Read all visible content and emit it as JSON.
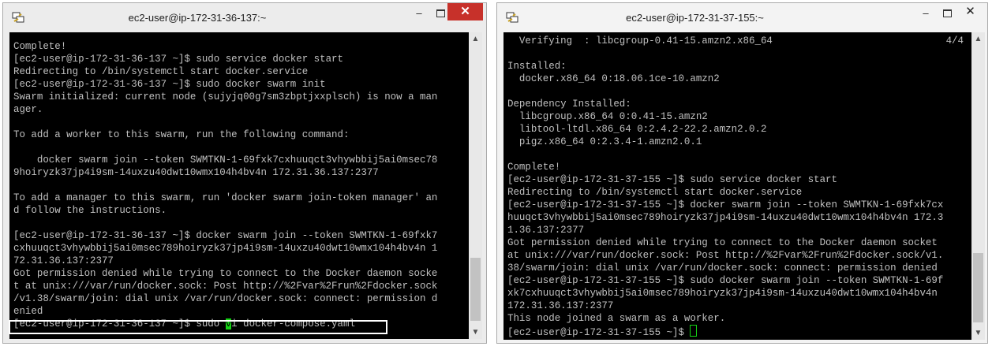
{
  "left_window": {
    "title": "ec2-user@ip-172-31-36-137:~",
    "controls": {
      "minimize": "–",
      "close": "✕"
    },
    "lines": [
      "Complete!",
      "[ec2-user@ip-172-31-36-137 ~]$ sudo service docker start",
      "Redirecting to /bin/systemctl start docker.service",
      "[ec2-user@ip-172-31-36-137 ~]$ sudo docker swarm init",
      "Swarm initialized: current node (sujyjq00g7sm3zbptjxxplsch) is now a man",
      "ager.",
      "",
      "To add a worker to this swarm, run the following command:",
      "",
      "    docker swarm join --token SWMTKN-1-69fxk7cxhuuqct3vhywbbij5ai0msec78",
      "9hoiryzk37jp4i9sm-14uxzu40dwt10wmx104h4bv4n 172.31.36.137:2377",
      "",
      "To add a manager to this swarm, run 'docker swarm join-token manager' an",
      "d follow the instructions.",
      "",
      "[ec2-user@ip-172-31-36-137 ~]$ docker swarm join --token SWMTKN-1-69fxk7",
      "cxhuuqct3vhywbbij5ai0msec789hoiryzk37jp4i9sm-14uxzu40dwt10wmx104h4bv4n 1",
      "72.31.36.137:2377",
      "Got permission denied while trying to connect to the Docker daemon socke",
      "t at unix:///var/run/docker.sock: Post http://%2Fvar%2Frun%2Fdocker.sock",
      "/v1.38/swarm/join: dial unix /var/run/docker.sock: connect: permission d",
      "enied"
    ],
    "prompt_line": {
      "before": "[ec2-user@ip-172-31-36-137 ~]$ sudo ",
      "cursor": "v",
      "after": "i docker-compose.yaml"
    }
  },
  "right_window": {
    "title": "ec2-user@ip-172-31-37-155:~",
    "controls": {
      "minimize": "–",
      "close": "✕"
    },
    "first_line": {
      "text": "  Verifying  : libcgroup-0.41-15.amzn2.x86_64",
      "right": "4/4"
    },
    "lines": [
      "",
      "Installed:",
      "  docker.x86_64 0:18.06.1ce-10.amzn2",
      "",
      "Dependency Installed:",
      "  libcgroup.x86_64 0:0.41-15.amzn2",
      "  libtool-ltdl.x86_64 0:2.4.2-22.2.amzn2.0.2",
      "  pigz.x86_64 0:2.3.4-1.amzn2.0.1",
      "",
      "Complete!",
      "[ec2-user@ip-172-31-37-155 ~]$ sudo service docker start",
      "Redirecting to /bin/systemctl start docker.service",
      "[ec2-user@ip-172-31-37-155 ~]$ docker swarm join --token SWMTKN-1-69fxk7cx",
      "huuqct3vhywbbij5ai0msec789hoiryzk37jp4i9sm-14uxzu40dwt10wmx104h4bv4n 172.3",
      "1.36.137:2377",
      "Got permission denied while trying to connect to the Docker daemon socket",
      "at unix:///var/run/docker.sock: Post http://%2Fvar%2Frun%2Fdocker.sock/v1.",
      "38/swarm/join: dial unix /var/run/docker.sock: connect: permission denied",
      "[ec2-user@ip-172-31-37-155 ~]$ sudo docker swarm join --token SWMTKN-1-69f",
      "xk7cxhuuqct3vhywbbij5ai0msec789hoiryzk37jp4i9sm-14uxzu40dwt10wmx104h4bv4n",
      "172.31.36.137:2377",
      "This node joined a swarm as a worker."
    ],
    "prompt_line": {
      "before": "[ec2-user@ip-172-31-37-155 ~]$ "
    }
  },
  "colors": {
    "terminal_bg": "#000000",
    "terminal_fg": "#c0c0c0",
    "cursor": "#15d315",
    "close_button": "#c7312a"
  }
}
